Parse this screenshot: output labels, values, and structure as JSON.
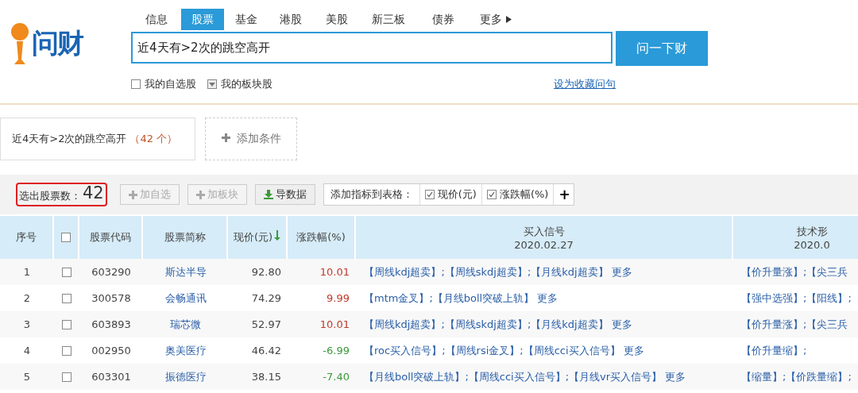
{
  "logo": {
    "text": "问财"
  },
  "nav_tabs": [
    {
      "label": "信息",
      "selected": false
    },
    {
      "label": "股票",
      "selected": true
    },
    {
      "label": "基金",
      "selected": false
    },
    {
      "label": "港股",
      "selected": false
    },
    {
      "label": "美股",
      "selected": false
    },
    {
      "label": "新三板",
      "selected": false
    },
    {
      "label": "债券",
      "selected": false
    },
    {
      "label": "更多",
      "selected": false,
      "kind": "menu"
    }
  ],
  "search": {
    "value": "近4天有>2次的跳空高开",
    "button": "问一下财"
  },
  "options": [
    {
      "label": "我的自选股",
      "checked": false,
      "kind": "checkbox"
    },
    {
      "label": "我的板块股",
      "kind": "dropdown"
    }
  ],
  "favorite_link": "设为收藏问句",
  "condition": {
    "text": "近4天有>2次的跳空高开",
    "count": "（42 个）",
    "add": "添加条件"
  },
  "toolbar": {
    "result_label": "选出股票数：",
    "result_count": "42",
    "buttons": [
      {
        "label": "加自选",
        "disabled": true,
        "kind": "plus"
      },
      {
        "label": "加板块",
        "disabled": true,
        "kind": "plus"
      },
      {
        "label": "导数据",
        "disabled": false,
        "kind": "download"
      }
    ],
    "indicator_label": "添加指标到表格：",
    "indicators": [
      {
        "label": "现价(元)",
        "checked": true
      },
      {
        "label": "涨跌幅(%)",
        "checked": true
      }
    ],
    "add_indicator": "+"
  },
  "table": {
    "columns": [
      {
        "label": "序号"
      },
      {
        "kind": "checkbox",
        "checked": false
      },
      {
        "label": "股票代码"
      },
      {
        "label": "股票简称"
      },
      {
        "label": "现价(元)",
        "sorted": true
      },
      {
        "label": "涨跌幅(%)"
      },
      {
        "label": "买入信号",
        "date": "2020.02.27"
      },
      {
        "label": "技术形",
        "date": "2020.0"
      }
    ],
    "rows": [
      {
        "index": "1",
        "checked": false,
        "code": "603290",
        "name": "斯达半导",
        "price": "92.80",
        "change": "10.01",
        "up": true,
        "signals": "【周线kdj超卖】;【周线skdj超卖】;【月线kdj超卖】 更多",
        "tech": "【价升量涨】;【尖三兵"
      },
      {
        "index": "2",
        "checked": false,
        "code": "300578",
        "name": "会畅通讯",
        "price": "74.29",
        "change": "9.99",
        "up": true,
        "signals": "【mtm金叉】;【月线boll突破上轨】 更多",
        "tech": "【强中选强】;【阳线】;"
      },
      {
        "index": "3",
        "checked": false,
        "code": "603893",
        "name": "瑞芯微",
        "price": "52.97",
        "change": "10.01",
        "up": true,
        "signals": "【周线kdj超卖】;【周线skdj超卖】;【月线kdj超卖】 更多",
        "tech": "【价升量涨】;【尖三兵"
      },
      {
        "index": "4",
        "checked": false,
        "code": "002950",
        "name": "奥美医疗",
        "price": "46.42",
        "change": "-6.99",
        "up": false,
        "signals": "【roc买入信号】;【周线rsi金叉】;【周线cci买入信号】 更多",
        "tech": "【价升量缩】;"
      },
      {
        "index": "5",
        "checked": false,
        "code": "603301",
        "name": "振德医疗",
        "price": "38.15",
        "change": "-7.40",
        "up": false,
        "signals": "【月线boll突破上轨】;【周线cci买入信号】;【月线vr买入信号】 更多",
        "tech": "【缩量】;【价跌量缩】;"
      }
    ]
  }
}
